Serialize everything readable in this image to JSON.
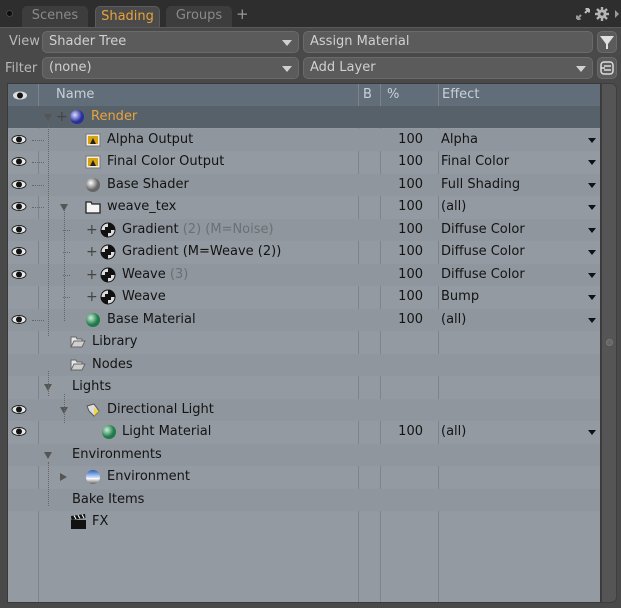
{
  "tabs": [
    {
      "label": "Scenes",
      "active": false
    },
    {
      "label": "Shading",
      "active": true
    },
    {
      "label": "Groups",
      "active": false
    }
  ],
  "tab_add": "+",
  "header_icons": [
    "maximize-icon",
    "gear-icon",
    "panel-menu-arrow-icon"
  ],
  "toolbar": {
    "view_label": "View",
    "view_value": "Shader Tree",
    "assign_material": "Assign Material",
    "filter_label": "Filter",
    "filter_value": "(none)",
    "add_layer": "Add Layer"
  },
  "columns": {
    "name": "Name",
    "b": "B",
    "pct": "%",
    "effect": "Effect"
  },
  "rows": [
    {
      "name": "Render",
      "extra": "",
      "icon": "render-sphere-icon",
      "visible": false,
      "pct": "",
      "effect": ""
    },
    {
      "name": "Alpha Output",
      "extra": "",
      "icon": "render-output-icon",
      "visible": true,
      "pct": "100",
      "effect": "Alpha"
    },
    {
      "name": "Final Color Output",
      "extra": "",
      "icon": "render-output-icon",
      "visible": true,
      "pct": "100",
      "effect": "Final Color"
    },
    {
      "name": "Base Shader",
      "extra": "",
      "icon": "shader-sphere-icon",
      "visible": true,
      "pct": "100",
      "effect": "Full Shading"
    },
    {
      "name": "weave_tex",
      "extra": "",
      "icon": "folder-icon",
      "visible": true,
      "pct": "100",
      "effect": "(all)"
    },
    {
      "name": "Gradient",
      "extra": "(2) (M=Noise)",
      "icon": "texture-ball-icon",
      "visible": true,
      "pct": "100",
      "effect": "Diffuse Color"
    },
    {
      "name": "Gradient (M=Weave (2))",
      "extra": "",
      "icon": "texture-ball-icon",
      "visible": true,
      "pct": "100",
      "effect": "Diffuse Color"
    },
    {
      "name": "Weave",
      "extra": "(3)",
      "icon": "texture-ball-icon",
      "visible": true,
      "pct": "100",
      "effect": "Diffuse Color"
    },
    {
      "name": "Weave",
      "extra": "",
      "icon": "texture-ball-icon",
      "visible": false,
      "pct": "100",
      "effect": "Bump"
    },
    {
      "name": "Base Material",
      "extra": "",
      "icon": "material-sphere-icon",
      "visible": true,
      "pct": "100",
      "effect": "(all)"
    },
    {
      "name": "Library",
      "extra": "",
      "icon": "open-folder-icon",
      "visible": false,
      "pct": "",
      "effect": ""
    },
    {
      "name": "Nodes",
      "extra": "",
      "icon": "open-folder-icon",
      "visible": false,
      "pct": "",
      "effect": ""
    },
    {
      "name": "Lights",
      "extra": "",
      "icon": "",
      "visible": false,
      "pct": "",
      "effect": ""
    },
    {
      "name": "Directional Light",
      "extra": "",
      "icon": "directional-light-icon",
      "visible": true,
      "pct": "",
      "effect": ""
    },
    {
      "name": "Light Material",
      "extra": "",
      "icon": "material-sphere-icon",
      "visible": true,
      "pct": "100",
      "effect": "(all)"
    },
    {
      "name": "Environments",
      "extra": "",
      "icon": "",
      "visible": false,
      "pct": "",
      "effect": ""
    },
    {
      "name": "Environment",
      "extra": "",
      "icon": "environment-icon",
      "visible": false,
      "pct": "",
      "effect": ""
    },
    {
      "name": "Bake Items",
      "extra": "",
      "icon": "",
      "visible": false,
      "pct": "",
      "effect": ""
    },
    {
      "name": "FX",
      "extra": "",
      "icon": "clapperboard-icon",
      "visible": false,
      "pct": "",
      "effect": ""
    }
  ],
  "colors": {
    "active_tab": "#e8a33d",
    "render_label": "#e8a33d",
    "header_bg": "#616e79",
    "tree_bg": "#939aa1"
  }
}
